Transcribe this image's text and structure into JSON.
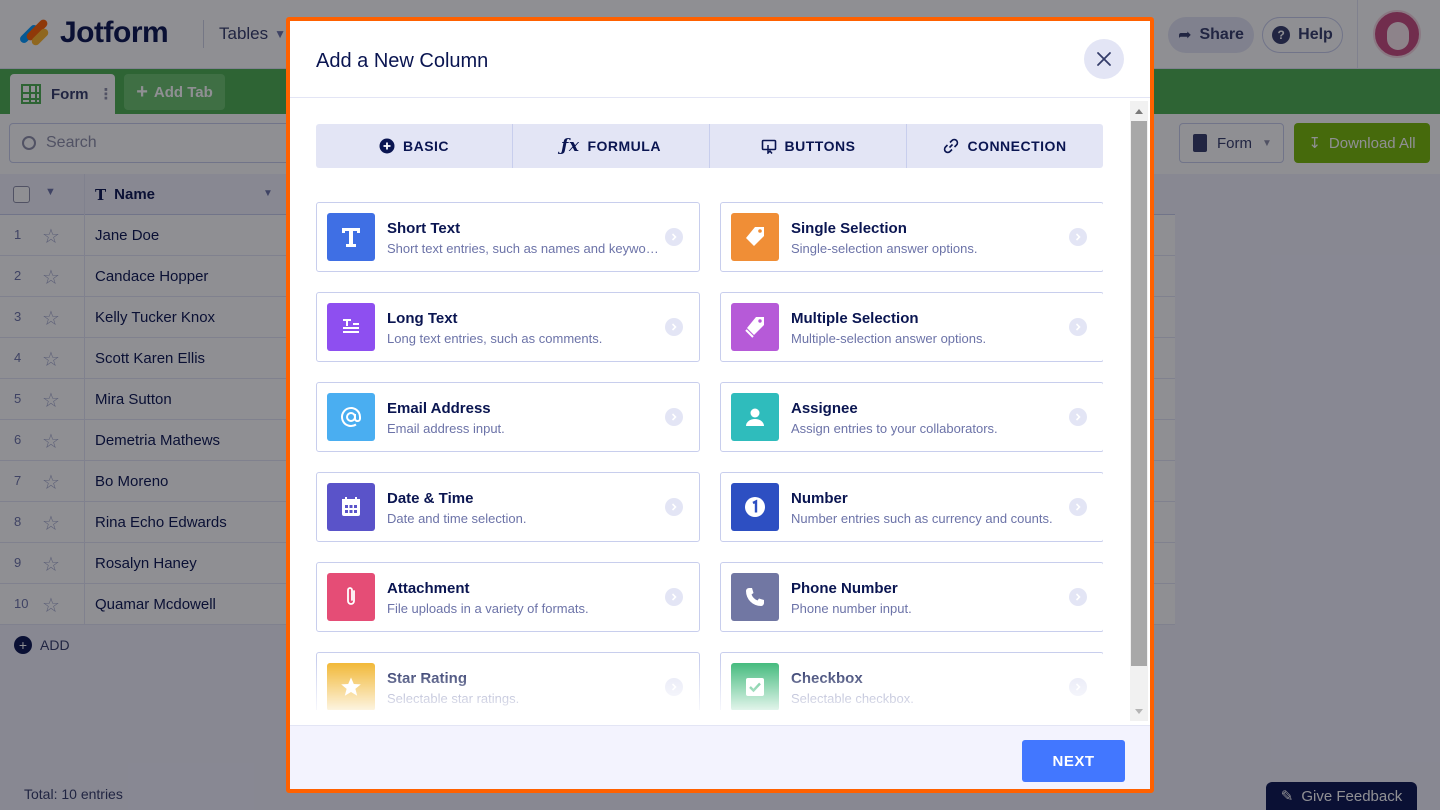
{
  "app": {
    "logo_text": "Jotform",
    "tables_menu": "Tables",
    "share": "Share",
    "help": "Help"
  },
  "tabs_bar": {
    "form_tab": "Form",
    "add_tab": "Add Tab"
  },
  "toolbar": {
    "search_placeholder": "Search",
    "form_select": "Form",
    "download_all": "Download All"
  },
  "table": {
    "name_header": "Name",
    "rows": [
      {
        "n": "1",
        "name": "Jane Doe"
      },
      {
        "n": "2",
        "name": "Candace Hopper"
      },
      {
        "n": "3",
        "name": "Kelly Tucker Knox"
      },
      {
        "n": "4",
        "name": "Scott Karen Ellis"
      },
      {
        "n": "5",
        "name": "Mira Sutton"
      },
      {
        "n": "6",
        "name": "Demetria Mathews"
      },
      {
        "n": "7",
        "name": "Bo Moreno"
      },
      {
        "n": "8",
        "name": "Rina Echo Edwards"
      },
      {
        "n": "9",
        "name": "Rosalyn Haney"
      },
      {
        "n": "10",
        "name": "Quamar Mcdowell"
      }
    ],
    "add_label": "ADD"
  },
  "footer": {
    "total": "Total: 10 entries",
    "feedback": "Give Feedback"
  },
  "modal": {
    "title": "Add a New Column",
    "tabs": [
      "BASIC",
      "FORMULA",
      "BUTTONS",
      "CONNECTION"
    ],
    "cards": [
      {
        "title": "Short Text",
        "desc": "Short text entries, such as names and keywords.",
        "icon": "text-t-icon",
        "color": "#3f6fe4"
      },
      {
        "title": "Single Selection",
        "desc": "Single-selection answer options.",
        "icon": "tag-icon",
        "color": "#f08e36"
      },
      {
        "title": "Long Text",
        "desc": "Long text entries, such as comments.",
        "icon": "long-text-icon",
        "color": "#8e4ff0"
      },
      {
        "title": "Multiple Selection",
        "desc": "Multiple-selection answer options.",
        "icon": "tags-icon",
        "color": "#b65ad8"
      },
      {
        "title": "Email Address",
        "desc": "Email address input.",
        "icon": "at-icon",
        "color": "#4aaef1"
      },
      {
        "title": "Assignee",
        "desc": "Assign entries to your collaborators.",
        "icon": "person-icon",
        "color": "#2fbcbc"
      },
      {
        "title": "Date & Time",
        "desc": "Date and time selection.",
        "icon": "calendar-icon",
        "color": "#5a53c9"
      },
      {
        "title": "Number",
        "desc": "Number entries such as currency and counts.",
        "icon": "number-one-icon",
        "color": "#2d4fc2"
      },
      {
        "title": "Attachment",
        "desc": "File uploads in a variety of formats.",
        "icon": "paperclip-icon",
        "color": "#e54d76"
      },
      {
        "title": "Phone Number",
        "desc": "Phone number input.",
        "icon": "phone-icon",
        "color": "#7177a3"
      },
      {
        "title": "Star Rating",
        "desc": "Selectable star ratings.",
        "icon": "star-icon",
        "color": "#f1b52e"
      },
      {
        "title": "Checkbox",
        "desc": "Selectable checkbox.",
        "icon": "checkbox-icon",
        "color": "#3cb878"
      }
    ],
    "next": "NEXT"
  }
}
